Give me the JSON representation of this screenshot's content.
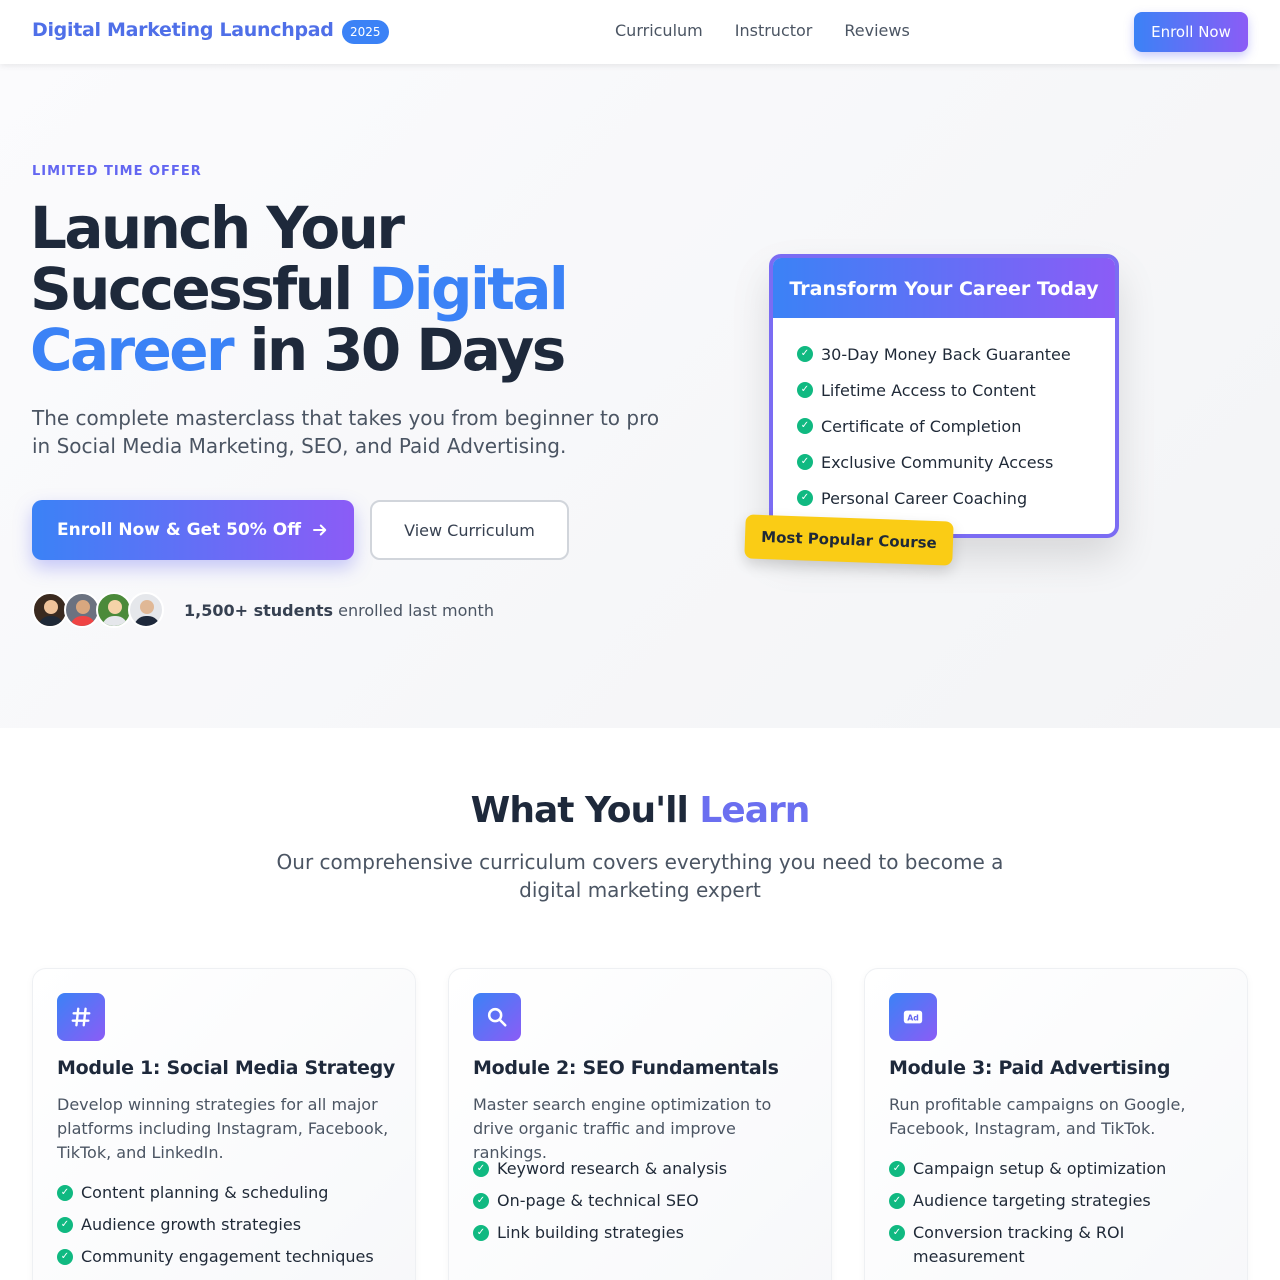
{
  "nav": {
    "brand": "Digital Marketing Launchpad",
    "year_badge": "2025",
    "links": [
      "Curriculum",
      "Instructor",
      "Reviews"
    ],
    "cta": "Enroll Now"
  },
  "hero": {
    "eyebrow": "LIMITED TIME OFFER",
    "headline_part1": "Launch Your Successful ",
    "headline_highlight": "Digital Career",
    "headline_part2": " in 30 Days",
    "subtitle": "The complete masterclass that takes you from beginner to pro in Social Media Marketing, SEO, and Paid Advertising.",
    "primary_cta": "Enroll Now & Get 50% Off",
    "secondary_cta": "View Curriculum",
    "students_count": "1,500+ students",
    "students_suffix": " enrolled last month"
  },
  "offer_card": {
    "title": "Transform Your Career Today",
    "items": [
      "30-Day Money Back Guarantee",
      "Lifetime Access to Content",
      "Certificate of Completion",
      "Exclusive Community Access",
      "Personal Career Coaching"
    ],
    "badge": "Most Popular Course"
  },
  "learn": {
    "title_part1": "What You'll ",
    "title_highlight": "Learn",
    "subtitle": "Our comprehensive curriculum covers everything you need to become a digital marketing expert",
    "modules": [
      {
        "icon": "hashtag-icon",
        "title": "Module 1: Social Media Strategy",
        "description": "Develop winning strategies for all major platforms including Instagram, Facebook, TikTok, and LinkedIn.",
        "items": [
          "Content planning & scheduling",
          "Audience growth strategies",
          "Community engagement techniques"
        ]
      },
      {
        "icon": "search-icon",
        "title": "Module 2: SEO Fundamentals",
        "description": "Master search engine optimization to drive organic traffic and improve rankings.",
        "items": [
          "Keyword research & analysis",
          "On-page & technical SEO",
          "Link building strategies"
        ]
      },
      {
        "icon": "ad-icon",
        "title": "Module 3: Paid Advertising",
        "description": "Run profitable campaigns on Google, Facebook, Instagram, and TikTok.",
        "items": [
          "Campaign setup & optimization",
          "Audience targeting strategies",
          "Conversion tracking & ROI measurement"
        ]
      }
    ]
  },
  "colors": {
    "accent_blue": "#3b82f6",
    "accent_purple": "#8b5cf6",
    "check_green": "#10b981",
    "badge_yellow": "#facc15"
  }
}
